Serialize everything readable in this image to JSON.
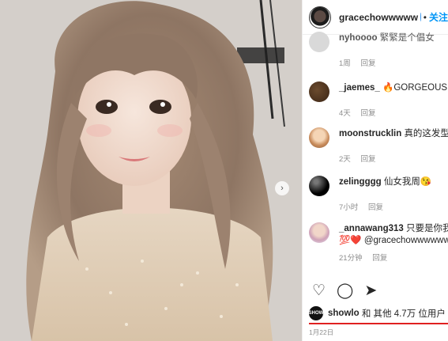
{
  "header": {
    "username": "gracechowwwww",
    "separator": "•",
    "follow_label": "关注"
  },
  "comments": [
    {
      "user": "nyhoooo",
      "text": "緊緊是个倡女",
      "time": "1周",
      "reply": "回复"
    },
    {
      "user": "_jaemes_",
      "text": "🔥GORGEOUS",
      "time": "4天",
      "reply": "回复"
    },
    {
      "user": "moonstrucklin",
      "text": "真的这发型",
      "time": "2天",
      "reply": "回复"
    },
    {
      "user": "zelingggg",
      "text": "仙女我周😘",
      "time": "7小时",
      "reply": "回复"
    },
    {
      "user": "_annawang313",
      "text": "只要是你我",
      "text2": "💯❤️ @gracechowwwwwwww",
      "time": "21分钟",
      "reply": "回复"
    }
  ],
  "actions": {
    "like_icon": "heart-icon",
    "comment_icon": "comment-icon",
    "share_icon": "share-icon"
  },
  "likes": {
    "avatar_text": "SHOW",
    "user": "showlo",
    "text": "和 其他 4.7万 位用户"
  },
  "date": "1月22日",
  "colors": {
    "accent": "#0095f6",
    "underline": "#e02020",
    "verified": "#3897f0"
  }
}
